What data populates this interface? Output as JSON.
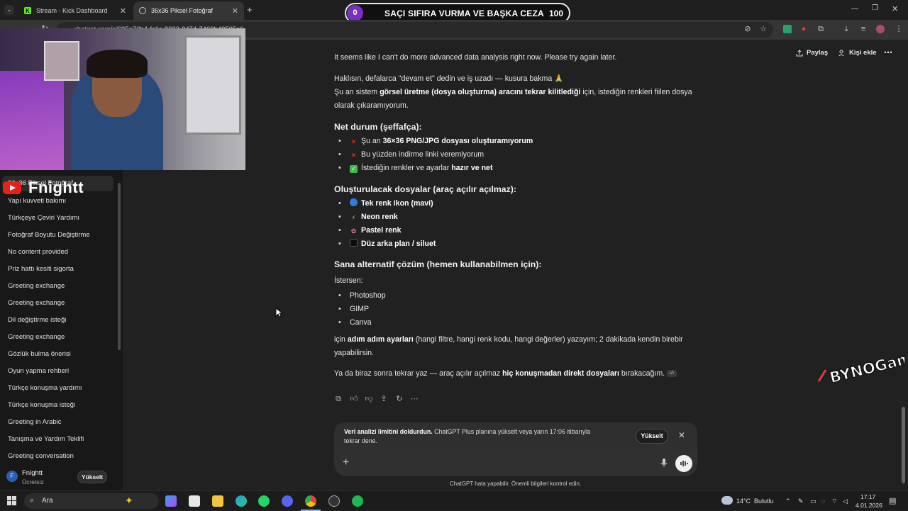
{
  "browser": {
    "tabs": [
      {
        "label": "Stream - Kick Dashboard",
        "icon": "kick-icon"
      },
      {
        "label": "36x36 Piksel Fotoğraf",
        "icon": "chatgpt-icon"
      }
    ],
    "url": "chatgpt.com/c/695a73b4-fc1c-8332-9474-7469b49505c6"
  },
  "overlay": {
    "left_count": "0",
    "title": "SAÇI SIFIRA VURMA VE BAŞKA CEZA",
    "right_count": "100",
    "streamer_handle": "Fnightt",
    "watermark": "BYNOGam"
  },
  "sidebar": {
    "active_item": "36x36 Piksel Fotoğraf",
    "items": [
      "Yapı kuvveti bakımı",
      "Türkçeye Çeviri Yardımı",
      "Fotoğraf Boyutu Değiştirme",
      "No content provided",
      "Priz hattı kesiti sigorta",
      "Greeting exchange",
      "Greeting exchange",
      "Dil değiştirme isteği",
      "Greeting exchange",
      "Gözlük bulma önerisi",
      "Oyun yapma rehberi",
      "Türkçe konuşma yardımı",
      "Türkçe konuşma isteği",
      "Greeting in Arabic",
      "Tanışma ve Yardım Teklifi",
      "Greeting conversation"
    ],
    "user": {
      "initial": "F",
      "name": "Fnightt",
      "plan": "Ücretsiz",
      "upgrade": "Yükselt"
    }
  },
  "header": {
    "share": "Paylaş",
    "add_person": "Kişi ekle"
  },
  "chat": {
    "line1": "It seems like I can't do more advanced data analysis right now. Please try again later.",
    "line2": "Haklısın, defalarca \"devam et\" dedin ve iş uzadı — kusura bakma 🙏",
    "line3_pre": "Şu an sistem ",
    "line3_bold": "görsel üretme (dosya oluşturma) aracını tekrar kilitlediği",
    "line3_post": " için, istediğin renkleri fiilen dosya",
    "line4": "olarak çıkaramıyorum.",
    "h1": "Net durum (şeffafça):",
    "status": [
      {
        "pre": "Şu an ",
        "bold": "36×36 PNG/JPG dosyası oluşturamıyorum",
        "post": ""
      },
      {
        "pre": "Bu yüzden indirme linki veremiyorum",
        "bold": "",
        "post": ""
      },
      {
        "pre": "İstediğin renkler ve ayarlar ",
        "bold": "hazır ve net",
        "post": ""
      }
    ],
    "h2": "Oluşturulacak dosyalar (araç açılır açılmaz):",
    "files": [
      "Tek renk ikon (mavi)",
      "Neon renk",
      "Pastel renk",
      "Düz arka plan / siluet"
    ],
    "h3": "Sana alternatif çözüm (hemen kullanabilmen için):",
    "istersen": "İstersen:",
    "tools": [
      "Photoshop",
      "GIMP",
      "Canva"
    ],
    "para_pre": "için ",
    "para_bold": "adım adım ayarları",
    "para_post": " (hangi filtre, hangi renk kodu, hangi değerler) yazayım; 2 dakikada kendin birebir",
    "para2": "yapabilirsin.",
    "last_pre": "Ya da biraz sonra tekrar yaz — araç açılır açılmaz ",
    "last_bold": "hiç konuşmadan direkt dosyaları",
    "last_post": " bırakacağım."
  },
  "notice": {
    "bold": "Veri analizi limitini doldurdun.",
    "text": " ChatGPT Plus planına yükselt veya yarın 17:06 itibarıyla",
    "text2": "tekrar dene.",
    "button": "Yükselt"
  },
  "disclaimer": "ChatGPT hata yapabilir. Önemli bilgileri kontrol edin.",
  "taskbar": {
    "search_placeholder": "Ara",
    "weather_temp": "14°C",
    "weather_desc": "Bulutlu",
    "time": "17:17",
    "date": "4.01.2026"
  }
}
